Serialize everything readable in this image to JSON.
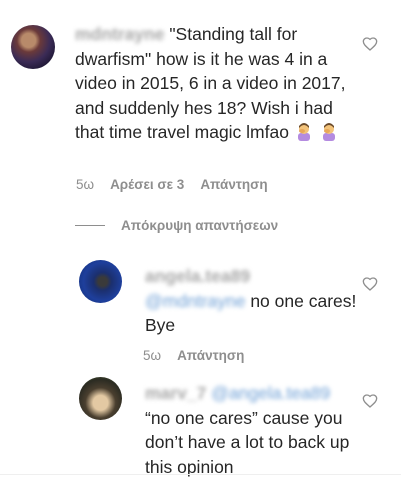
{
  "comments": [
    {
      "username": "mdntrayne",
      "text": "\"Standing tall for dwarfism\" how is it he was 4 in a video in 2015, 6 in a video in 2017, and suddenly hes 18? Wish i had that time travel magic lmfao",
      "emoji": "person-facepalming-emoji",
      "time": "5ω",
      "likes": "Αρέσει σε 3",
      "reply": "Απάντηση"
    },
    {
      "username": "angela.tea89",
      "mention": "@mdntrayne",
      "text": "no one cares! Bye",
      "time": "5ω",
      "reply": "Απάντηση"
    },
    {
      "username": "marv_7",
      "mention": "@angela.tea89",
      "text": "“no one cares” cause you don’t have a lot to back up this opinion"
    }
  ],
  "hide_replies_label": "Απόκρυψη απαντήσεων",
  "colors": {
    "text": "#262626",
    "secondary": "#8e8e8e",
    "mention": "#6fa0d6"
  }
}
